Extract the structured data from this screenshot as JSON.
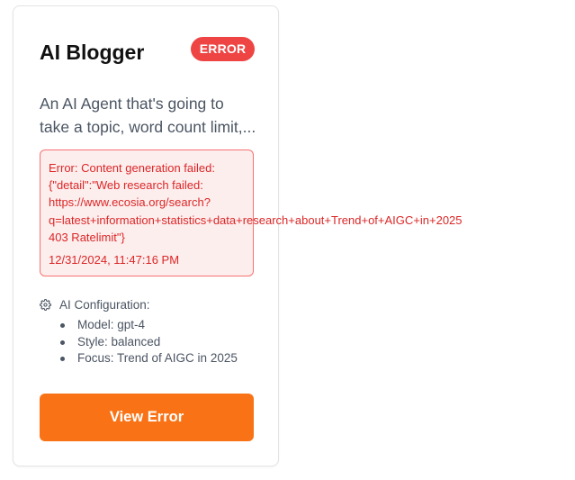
{
  "card": {
    "title": "AI Blogger",
    "status_badge": "ERROR",
    "description_lines": [
      "An AI Agent that's going to",
      "take a topic, word count limit,..."
    ],
    "error": {
      "message_lines": [
        "Error: Content generation failed:",
        "{\"detail\":\"Web research failed:",
        "https://www.ecosia.org/search?",
        "q=latest+information+statistics+data+research+about+Trend+of+AIGC+in+2025",
        "403 Ratelimit\"}"
      ],
      "timestamp": "12/31/2024, 11:47:16 PM"
    },
    "config": {
      "header": "AI Configuration:",
      "icon": "gear-icon",
      "items": [
        "Model: gpt-4",
        "Style: balanced",
        "Focus: Trend of AIGC in 2025"
      ]
    },
    "action_button": "View Error"
  },
  "colors": {
    "error_badge": "#ef4444",
    "error_text": "#dc2626",
    "error_background": "#fdeeee",
    "error_border": "#f87171",
    "button": "#f97316",
    "body_text": "#4b5563"
  }
}
